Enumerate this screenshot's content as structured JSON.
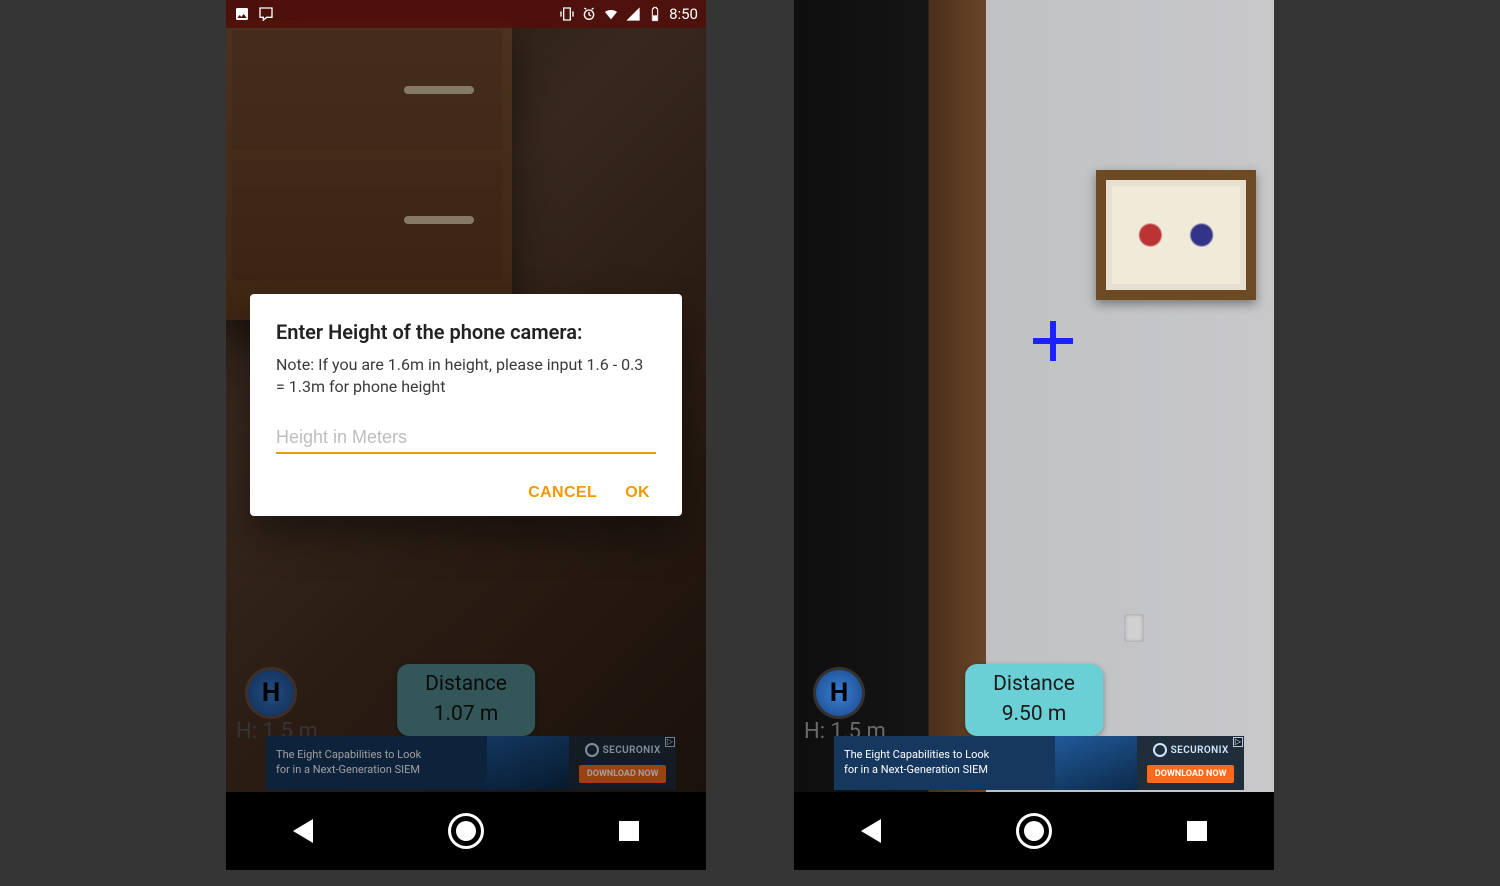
{
  "statusbar": {
    "time": "8:50"
  },
  "dialog": {
    "title": "Enter Height of the phone camera:",
    "note": "Note: If you are 1.6m in height, please input 1.6 - 0.3 = 1.3m for phone height",
    "placeholder": "Height in Meters",
    "cancel": "CANCEL",
    "ok": "OK"
  },
  "phone1": {
    "height_label": "H: 1.5 m",
    "h_badge": "H",
    "distance_label": "Distance",
    "distance_value": "1.07 m"
  },
  "phone2": {
    "height_label": "H: 1.5 m",
    "h_badge": "H",
    "distance_label": "Distance",
    "distance_value": "9.50 m"
  },
  "ad": {
    "line1": "The Eight Capabilities to Look",
    "line2": "for in a Next-Generation SIEM",
    "brand": "SECURONIX",
    "cta": "DOWNLOAD NOW"
  }
}
